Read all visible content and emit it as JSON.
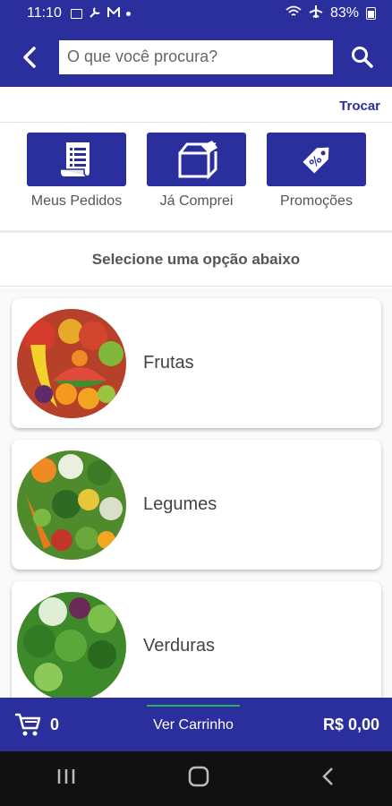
{
  "status_bar": {
    "time": "11:10",
    "battery": "83%",
    "icons": [
      "image-icon",
      "wrench-icon",
      "gmail-icon",
      "dot-icon",
      "wifi-icon",
      "airplane-icon",
      "battery-icon"
    ]
  },
  "header": {
    "search_placeholder": "O que você procura?",
    "icons": [
      "back-icon",
      "search-icon"
    ]
  },
  "trocar_label": "Trocar",
  "quick_actions": [
    {
      "label": "Meus Pedidos",
      "icon": "receipt-icon"
    },
    {
      "label": "Já Comprei",
      "icon": "box-icon"
    },
    {
      "label": "Promoções",
      "icon": "tag-icon"
    }
  ],
  "section_title": "Selecione uma opção abaixo",
  "categories": [
    {
      "label": "Frutas",
      "icon": "fruits-image"
    },
    {
      "label": "Legumes",
      "icon": "vegetables-image"
    },
    {
      "label": "Verduras",
      "icon": "greens-image"
    }
  ],
  "cart": {
    "count": "0",
    "view_label": "Ver Carrinho",
    "total": "R$ 0,00"
  },
  "colors": {
    "primary": "#2b2f9e",
    "accent_line": "#2fb35a",
    "nav_bar": "#111111"
  }
}
